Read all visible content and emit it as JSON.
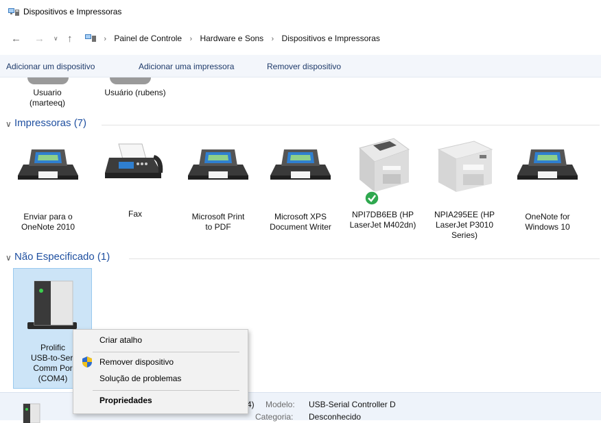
{
  "window": {
    "title": "Dispositivos e Impressoras"
  },
  "address": {
    "breadcrumbs": [
      "Painel de Controle",
      "Hardware e Sons",
      "Dispositivos e Impressoras"
    ]
  },
  "toolbar": {
    "add_device": "Adicionar um dispositivo",
    "add_printer": "Adicionar uma impressora",
    "remove_device": "Remover dispositivo"
  },
  "users": [
    {
      "line1": "Usuario",
      "line2": "(marteeq)"
    },
    {
      "line1": "Usuário (rubens)",
      "line2": ""
    }
  ],
  "printers_group": {
    "title": "Impressoras (7)",
    "items": [
      {
        "line1": "Enviar para o",
        "line2": "OneNote 2010",
        "line3": "",
        "icon": "printer-icon"
      },
      {
        "line1": "Fax",
        "line2": "",
        "line3": "",
        "icon": "fax-icon"
      },
      {
        "line1": "Microsoft Print",
        "line2": "to PDF",
        "line3": "",
        "icon": "printer-icon"
      },
      {
        "line1": "Microsoft XPS",
        "line2": "Document Writer",
        "line3": "",
        "icon": "printer-icon"
      },
      {
        "line1": "NPI7DB6EB (HP",
        "line2": "LaserJet M402dn)",
        "line3": "",
        "icon": "laser-printer-icon"
      },
      {
        "line1": "NPIA295EE (HP",
        "line2": "LaserJet P3010",
        "line3": "Series)",
        "icon": "laser-printer-icon"
      },
      {
        "line1": "OneNote for",
        "line2": "Windows 10",
        "line3": "",
        "icon": "printer-icon"
      }
    ]
  },
  "unspecified_group": {
    "title": "Não Especificado (1)",
    "items": [
      {
        "line1": "Prolific",
        "line2": "USB-to-Seri",
        "line3": "Comm Por",
        "line4": "(COM4)"
      }
    ]
  },
  "context_menu": {
    "items": [
      "Criar atalho",
      "Remover dispositivo",
      "Solução de problemas",
      "Propriedades"
    ]
  },
  "details": {
    "name_suffix": "4)",
    "model_label": "Modelo:",
    "model_value": "USB-Serial Controller D",
    "category_label": "Categoria:",
    "category_value": "Desconhecido"
  },
  "colors": {
    "accent": "#1e4fa0",
    "selection": "#cce4f7",
    "default_check": "#2fa84f"
  }
}
